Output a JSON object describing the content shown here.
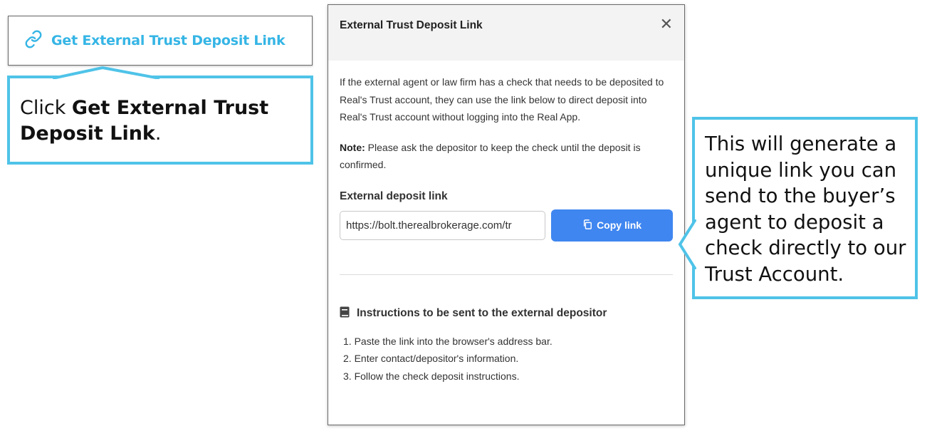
{
  "trigger": {
    "label": "Get External Trust Deposit Link",
    "icon": "link-icon",
    "color": "#35b5e5"
  },
  "callouts": {
    "left": {
      "prefix": "Click ",
      "bold": "Get External Trust Deposit Link",
      "suffix": "."
    },
    "right": {
      "text": "This will generate a unique link you can send to the buyer’s agent to deposit a check directly to our Trust Account."
    },
    "border_color": "#4fc3e8"
  },
  "modal": {
    "title": "External Trust Deposit Link",
    "close_icon": "close-icon",
    "description": "If the external agent or law firm has a check that needs to be deposited to Real's Trust account, they can use the link below to direct deposit into Real's Trust account without logging into the Real App.",
    "note_label": "Note:",
    "note_text": " Please ask the depositor to keep the check until the deposit is confirmed.",
    "field_label": "External deposit link",
    "link_value": "https://bolt.therealbrokerage.com/tr",
    "copy_label": "Copy link",
    "copy_color": "#3f86f0",
    "instructions_title": "Instructions to be sent to the external depositor",
    "instructions": [
      "1. Paste the link into the browser's address bar.",
      "2. Enter contact/depositor's information.",
      "3. Follow the check deposit instructions."
    ]
  }
}
